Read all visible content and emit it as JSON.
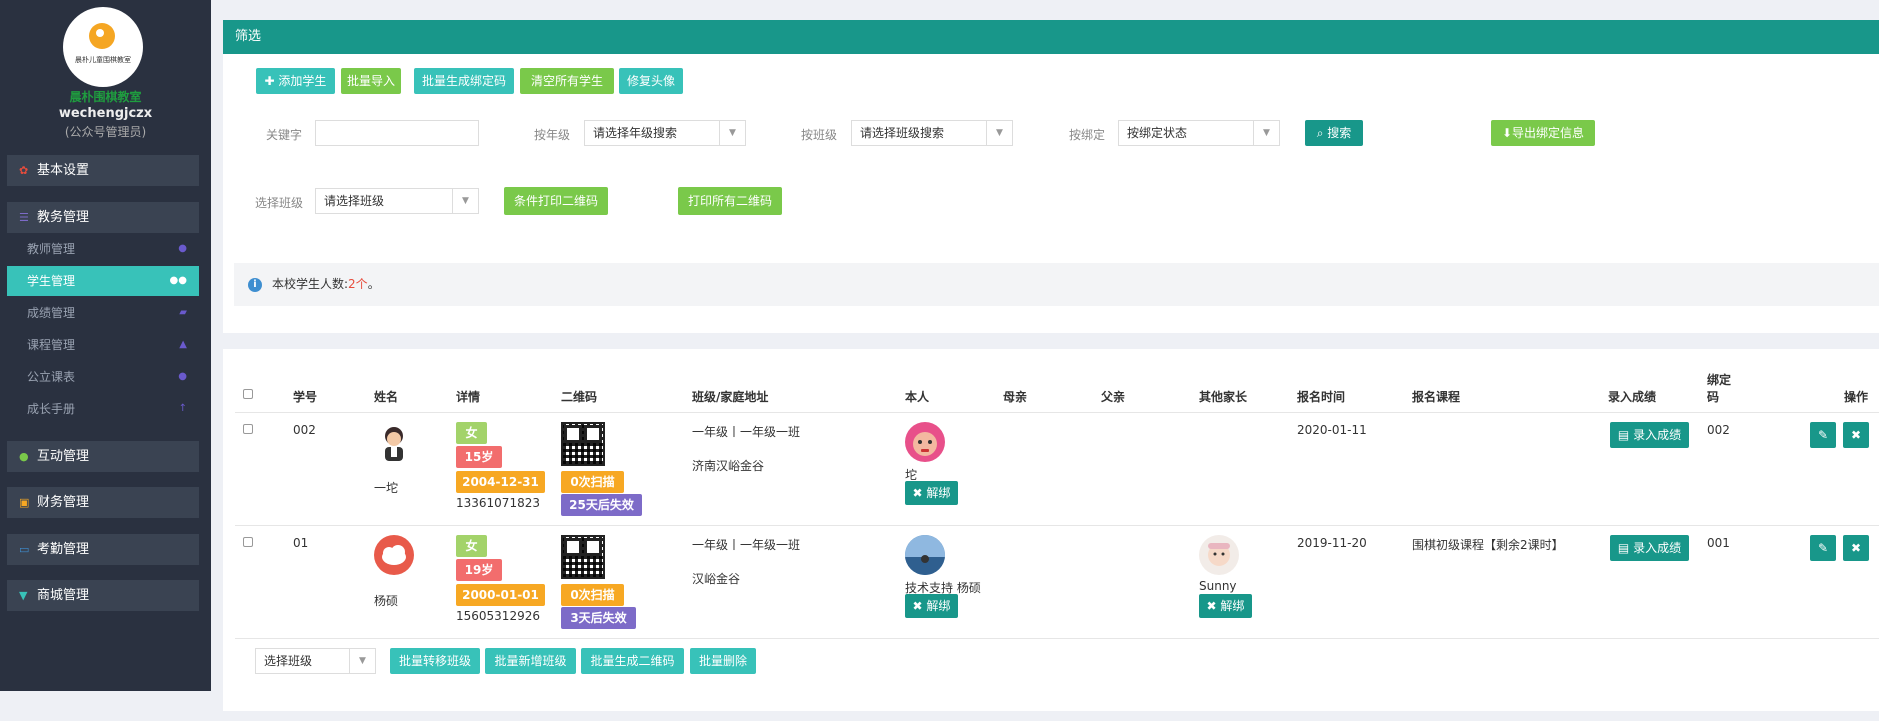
{
  "sidebar": {
    "logo_text": "晨朴儿童围棋教室",
    "school_name": "晨朴围棋教室",
    "username": "wechengjczx",
    "role": "(公众号管理员)",
    "groups": [
      {
        "label": "基本设置",
        "icon": "gear-icon"
      },
      {
        "label": "教务管理",
        "icon": "list-icon"
      },
      {
        "label": "互动管理",
        "icon": "chat-icon"
      },
      {
        "label": "财务管理",
        "icon": "money-icon"
      },
      {
        "label": "考勤管理",
        "icon": "card-icon"
      },
      {
        "label": "商城管理",
        "icon": "cart-icon"
      }
    ],
    "sub_items": [
      {
        "label": "教师管理",
        "icon": "user-icon"
      },
      {
        "label": "学生管理",
        "icon": "users-icon"
      },
      {
        "label": "成绩管理",
        "icon": "book-icon"
      },
      {
        "label": "课程管理",
        "icon": "graduation-icon"
      },
      {
        "label": "公立课表",
        "icon": "clock-icon"
      },
      {
        "label": "成长手册",
        "icon": "arrow-up-icon"
      }
    ]
  },
  "filter": {
    "header": "筛选",
    "actions": {
      "add_student": "添加学生",
      "batch_import": "批量导入",
      "batch_bind_code": "批量生成绑定码",
      "clear_all": "清空所有学生",
      "fix_avatar": "修复头像"
    },
    "keyword_label": "关键字",
    "grade_label": "按年级",
    "grade_select": "请选择年级搜索",
    "class_label": "按班级",
    "class_select": "请选择班级搜索",
    "bind_label": "按绑定",
    "bind_select": "按绑定状态",
    "search_button": "搜索",
    "export_button": "导出绑定信息",
    "choose_class_label": "选择班级",
    "choose_class_select": "请选择班级",
    "print_cond_button": "条件打印二维码",
    "print_all_button": "打印所有二维码",
    "info_prefix": "本校学生人数:",
    "info_count": "2个",
    "info_suffix": "。"
  },
  "table": {
    "headers": {
      "id": "学号",
      "name": "姓名",
      "detail": "详情",
      "qrcode": "二维码",
      "class_address": "班级/家庭地址",
      "self": "本人",
      "mother": "母亲",
      "father": "父亲",
      "other_parent": "其他家长",
      "signup_time": "报名时间",
      "signup_course": "报名课程",
      "enter_score": "录入成绩",
      "bind_code_l1": "绑定",
      "bind_code_l2": "码",
      "operations": "操作"
    },
    "rows": [
      {
        "student_id": "002",
        "name": "一坨",
        "gender": "女",
        "age": "15岁",
        "birthday": "2004-12-31",
        "phone": "13361071823",
        "scan_count": "0次扫描",
        "expiry": "25天后失效",
        "class_name": "一年级丨一年级一班",
        "address": "济南汉峪金谷",
        "self_name": "坨",
        "unbind": "解绑",
        "other_parent_name": "",
        "signup_time": "2020-01-11",
        "course": "",
        "enter_score": "录入成绩",
        "bind_code": "002"
      },
      {
        "student_id": "01",
        "name": "杨硕",
        "gender": "女",
        "age": "19岁",
        "birthday": "2000-01-01",
        "phone": "15605312926",
        "scan_count": "0次扫描",
        "expiry": "3天后失效",
        "class_name": "一年级丨一年级一班",
        "address": "汉峪金谷",
        "self_name": "技术支持 杨硕",
        "unbind": "解绑",
        "other_parent_name": "Sunny",
        "signup_time": "2019-11-20",
        "course": "围棋初级课程【剩余2课时】",
        "enter_score": "录入成绩",
        "bind_code": "001"
      }
    ],
    "footer": {
      "choose_class": "选择班级",
      "batch_transfer": "批量转移班级",
      "batch_add_class": "批量新增班级",
      "batch_qrcode": "批量生成二维码",
      "batch_delete": "批量删除"
    }
  },
  "colors": {
    "sidebar_bg": "#2a3140",
    "teal": "#38c2b9",
    "dark_teal": "#18978a",
    "green": "#7ac94a",
    "accent_red": "#e74c3c"
  }
}
